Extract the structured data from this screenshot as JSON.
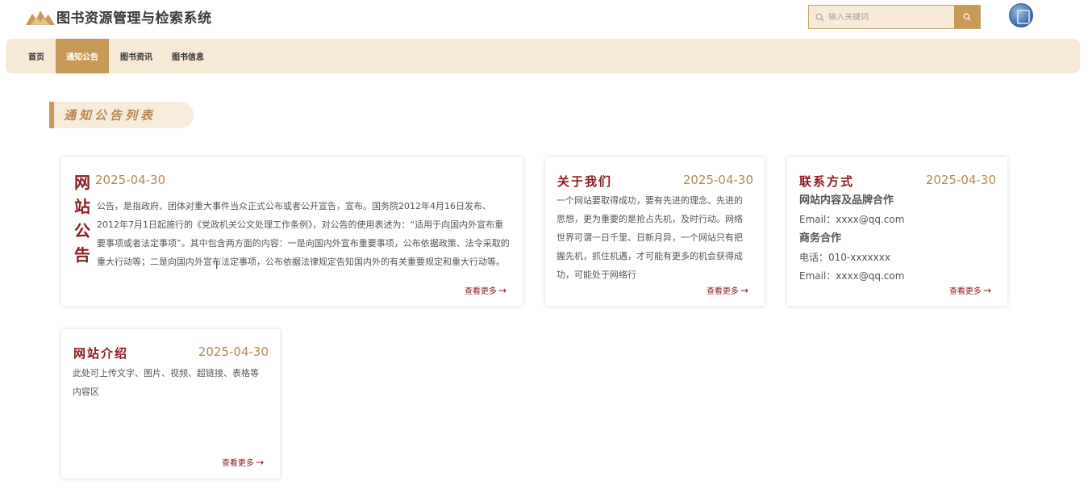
{
  "header": {
    "app_title": "图书资源管理与检索系统",
    "search": {
      "placeholder": "输入关键词",
      "value": ""
    }
  },
  "nav": {
    "items": [
      {
        "label": "首页",
        "active": false
      },
      {
        "label": "通知公告",
        "active": true
      },
      {
        "label": "图书资讯",
        "active": false
      },
      {
        "label": "图书信息",
        "active": false
      }
    ]
  },
  "section": {
    "title": "通知公告列表"
  },
  "cards": {
    "notice": {
      "title_chars": [
        "网",
        "站",
        "公",
        "告"
      ],
      "date": "2025-04-30",
      "body": "公告，是指政府、团体对重大事件当众正式公布或者公开宣告，宣布。国务院2012年4月16日发布、2012年7月1日起施行的《党政机关公文处理工作条例》，对公告的使用表述为：“适用于向国内外宣布重要事项或者法定事项”。其中包含两方面的内容：一是向国内外宣布重要事项，公布依据政策、法令采取的重大行动等；二是向国内外宣布法定事项，公布依据法律规定告知国内外的有关重要规定和重大行动等。",
      "more": "查看更多"
    },
    "about": {
      "title": "关于我们",
      "date": "2025-04-30",
      "body": "一个网站要取得成功，要有先进的理念、先进的思想，更为重要的是抢占先机，及时行动。网络世界可谓一日千里、日新月异，一个网站只有把握先机，抓住机遇，才可能有更多的机会获得成功，可能处于网络行",
      "more": "查看更多"
    },
    "contact": {
      "title": "联系方式",
      "date": "2025-04-30",
      "head1": "网站内容及品牌合作",
      "email1": "Email：xxxx@qq.com",
      "head2": "商务合作",
      "phone": "电话：010-xxxxxxx",
      "email2": "Email：xxxx@qq.com",
      "more": "查看更多"
    },
    "intro": {
      "title": "网站介绍",
      "date": "2025-04-30",
      "body": "此处可上传文字、图片、视频、超链接、表格等内容区",
      "more": "查看更多"
    }
  },
  "colors": {
    "accent": "#c79a57",
    "nav_bg": "#f6ead7",
    "title_red": "#8b1c24",
    "date_gold": "#b28a52"
  },
  "icons": {
    "logo": "mountain-logo-icon",
    "search": "search-icon",
    "arrow": "arrow-right-icon"
  }
}
